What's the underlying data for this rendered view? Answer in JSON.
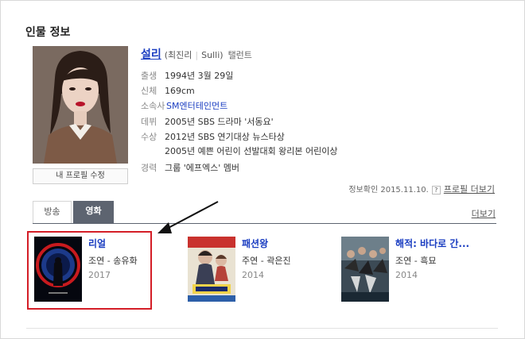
{
  "section_title": "인물 정보",
  "profile": {
    "name": "설리",
    "aka_korean": "(최진리",
    "aka_english": "Sulli)",
    "occupation": "탤런트",
    "edit_button": "내 프로필 수정"
  },
  "info": [
    {
      "label": "출생",
      "value": "1994년 3월 29일"
    },
    {
      "label": "신체",
      "value": "169cm"
    },
    {
      "label": "소속사",
      "value": "SM엔터테인먼트",
      "link": true
    },
    {
      "label": "데뷔",
      "value": "2005년 SBS 드라마 '서동요'"
    },
    {
      "label": "수상",
      "value": "2012년 SBS 연기대상 뉴스타상"
    },
    {
      "label": "",
      "value": "2005년 예쁜 어린이 선발대회 왕리본 어린이상"
    },
    {
      "label": "경력",
      "value": "그룹 '에프엑스' 멤버"
    }
  ],
  "verify": {
    "text": "정보확인 2015.11.10.",
    "help": "?",
    "more_profile": "프로필 더보기"
  },
  "tabs": [
    {
      "label": "방송",
      "active": false
    },
    {
      "label": "영화",
      "active": true
    }
  ],
  "more_label": "더보기",
  "movies": [
    {
      "title": "리얼",
      "role": "조연 - 송유화",
      "year": "2017"
    },
    {
      "title": "패션왕",
      "role": "주연 - 곽은진",
      "year": "2014"
    },
    {
      "title": "해적: 바다로 간...",
      "role": "조연 - 흑묘",
      "year": "2014"
    }
  ],
  "colors": {
    "link": "#1a3dc1",
    "active_tab": "#5d6470",
    "highlight": "#d41e27"
  }
}
